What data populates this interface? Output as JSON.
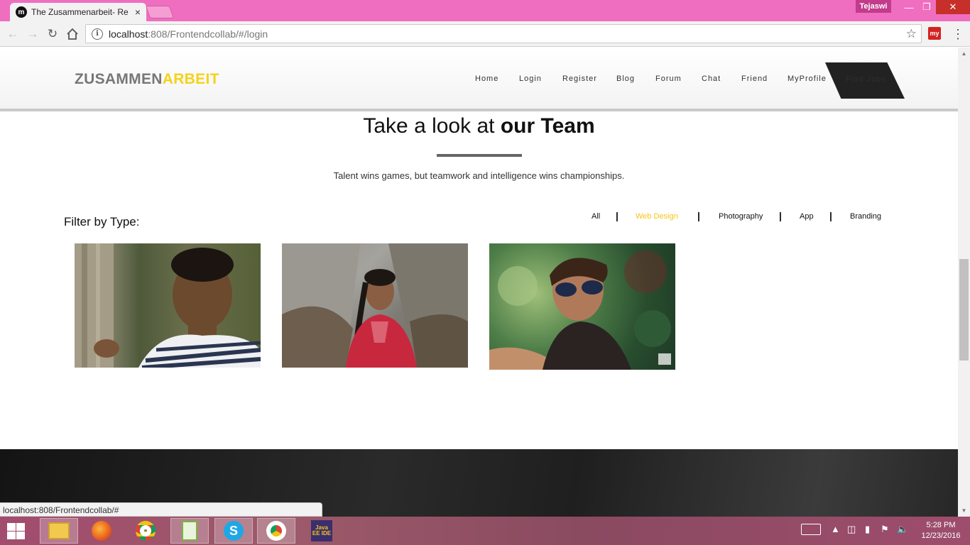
{
  "browser": {
    "tab_title": "The Zusammenarbeit- Re",
    "tab_close": "×",
    "favicon_letter": "m",
    "user_badge": "Tejaswi",
    "url_host": "localhost",
    "url_path": ":808/Frontendcollab/#/login",
    "info_glyph": "i",
    "extension_label": "my",
    "status_url": "localhost:808/Frontendcollab/#"
  },
  "site": {
    "logo_part1": "ZUSAMMEN",
    "logo_part2": "ARBEIT",
    "nav": [
      {
        "label": "Home"
      },
      {
        "label": "Login"
      },
      {
        "label": "Register"
      },
      {
        "label": "Blog"
      },
      {
        "label": "Forum"
      },
      {
        "label": "Chat"
      },
      {
        "label": "Friend"
      },
      {
        "label": "MyProfile"
      }
    ],
    "find_jobs": "Find Jobs"
  },
  "team": {
    "title_plain": "Take a look at ",
    "title_bold": "our Team",
    "tagline": "Talent wins games, but teamwork and intelligence wins championships.",
    "filter_label": "Filter by Type:",
    "filters": [
      {
        "label": "All",
        "active": false
      },
      {
        "label": "Web Design",
        "active": true
      },
      {
        "label": "Photography",
        "active": false
      },
      {
        "label": "App",
        "active": false
      },
      {
        "label": "Branding",
        "active": false
      }
    ],
    "filter_separator": "|"
  },
  "taskbar": {
    "time": "5:28 PM",
    "date": "12/23/2016",
    "apps": [
      "file-explorer",
      "firefox",
      "chrome",
      "notepad-plus-plus",
      "skype",
      "chrome",
      "java-ee-ide"
    ],
    "java_label": "Java EE IDE"
  },
  "colors": {
    "accent_yellow": "#f5d21a",
    "titlebar_pink": "#f06ec0"
  }
}
